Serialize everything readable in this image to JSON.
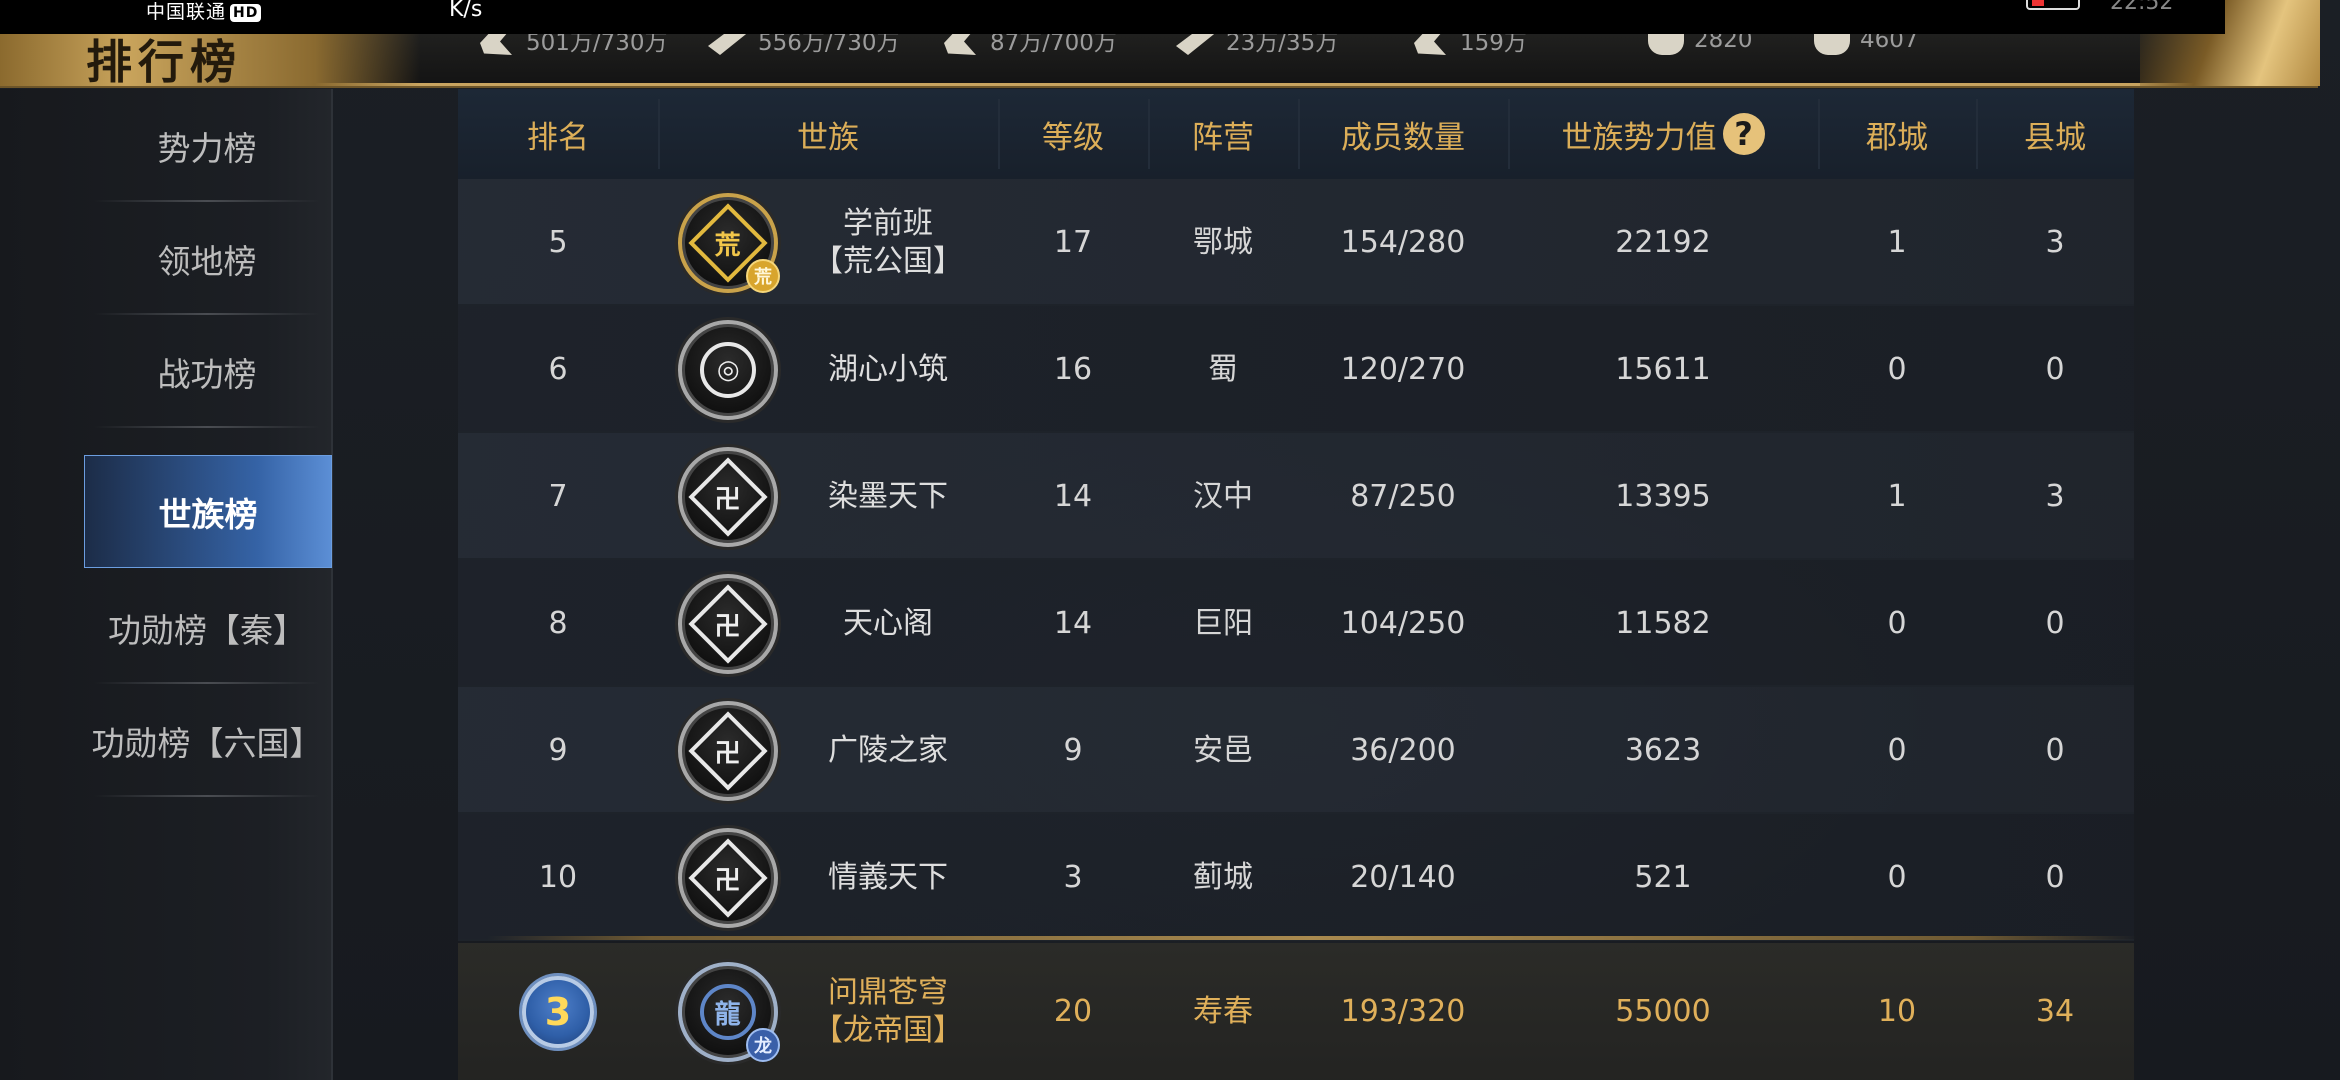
{
  "status_bar": {
    "carrier": "中国联通",
    "hd_badge": "HD",
    "net_speed": "K/s",
    "clock": "22:52"
  },
  "banner": {
    "title": "排行榜",
    "resources": [
      {
        "icon": "grain-icon",
        "value": "501万/730万"
      },
      {
        "icon": "wood-icon",
        "value": "556万/730万"
      },
      {
        "icon": "stone-icon",
        "value": "87万/700万"
      },
      {
        "icon": "iron-icon",
        "value": "23万/35万"
      },
      {
        "icon": "copper-icon",
        "value": "159万"
      },
      {
        "icon": "gold-ingot-icon",
        "value": "2820"
      },
      {
        "icon": "silver-ingot-icon",
        "value": "4607"
      }
    ]
  },
  "sidebar": {
    "items": [
      {
        "label": "势力榜",
        "active": false
      },
      {
        "label": "领地榜",
        "active": false
      },
      {
        "label": "战功榜",
        "active": false
      },
      {
        "label": "世族榜",
        "active": true
      },
      {
        "label": "功勋榜【秦】",
        "active": false
      },
      {
        "label": "功勋榜【六国】",
        "active": false
      }
    ]
  },
  "table": {
    "headers": {
      "rank": "排名",
      "clan": "世族",
      "level": "等级",
      "faction": "阵营",
      "members": "成员数量",
      "power": "世族势力值",
      "prefecture": "郡城",
      "county": "县城"
    },
    "rows": [
      {
        "rank": "5",
        "clan_line1": "学前班",
        "clan_line2": "【荒公国】",
        "emblem": "gold-crown-emblem-icon",
        "emblem_glyph": "荒",
        "emblem_style": "gold",
        "badge": "荒",
        "level": "17",
        "faction": "鄂城",
        "members": "154/280",
        "power": "22192",
        "prefecture": "1",
        "county": "3"
      },
      {
        "rank": "6",
        "clan_line1": "湖心小筑",
        "clan_line2": "",
        "emblem": "swirl-emblem-icon",
        "emblem_glyph": "◎",
        "emblem_style": "silver",
        "badge": "",
        "level": "16",
        "faction": "蜀",
        "members": "120/270",
        "power": "15611",
        "prefecture": "0",
        "county": "0"
      },
      {
        "rank": "7",
        "clan_line1": "染墨天下",
        "clan_line2": "",
        "emblem": "default-clan-emblem-icon",
        "emblem_glyph": "卍",
        "emblem_style": "silver",
        "badge": "",
        "level": "14",
        "faction": "汉中",
        "members": "87/250",
        "power": "13395",
        "prefecture": "1",
        "county": "3"
      },
      {
        "rank": "8",
        "clan_line1": "天心阁",
        "clan_line2": "",
        "emblem": "default-clan-emblem-icon",
        "emblem_glyph": "卍",
        "emblem_style": "silver",
        "badge": "",
        "level": "14",
        "faction": "巨阳",
        "members": "104/250",
        "power": "11582",
        "prefecture": "0",
        "county": "0"
      },
      {
        "rank": "9",
        "clan_line1": "广陵之家",
        "clan_line2": "",
        "emblem": "default-clan-emblem-icon",
        "emblem_glyph": "卍",
        "emblem_style": "silver",
        "badge": "",
        "level": "9",
        "faction": "安邑",
        "members": "36/200",
        "power": "3623",
        "prefecture": "0",
        "county": "0"
      },
      {
        "rank": "10",
        "clan_line1": "情義天下",
        "clan_line2": "",
        "emblem": "default-clan-emblem-icon",
        "emblem_glyph": "卍",
        "emblem_style": "silver",
        "badge": "",
        "level": "3",
        "faction": "蓟城",
        "members": "20/140",
        "power": "521",
        "prefecture": "0",
        "county": "0"
      }
    ],
    "own_row": {
      "rank": "3",
      "clan_line1": "问鼎苍穹",
      "clan_line2": "【龙帝国】",
      "emblem": "dragon-emblem-icon",
      "emblem_glyph": "龍",
      "badge": "龙",
      "level": "20",
      "faction": "寿春",
      "members": "193/320",
      "power": "55000",
      "prefecture": "10",
      "county": "34"
    }
  },
  "colors": {
    "header_text": "#dcae58",
    "own_row_text": "#e0b05a",
    "active_tab": "#3563a6",
    "gold_trim": "#c8a460"
  }
}
